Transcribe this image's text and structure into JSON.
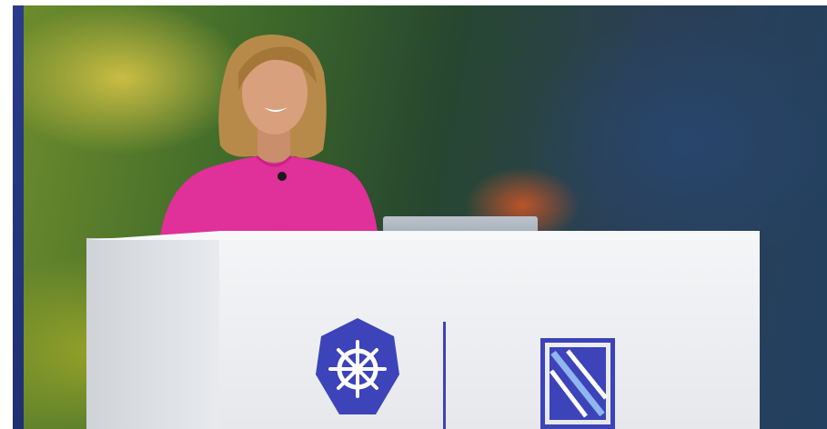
{
  "scene": {
    "description_colors": {
      "backdrop_green": "#3f6a2a",
      "backdrop_blue": "#2b3f55",
      "autumn_orange": "#c45428",
      "jacket_pink": "#e0309a",
      "hair_blonde": "#b88a4a",
      "lectern_white": "#eef0f3",
      "logo_blue": "#3d43b8"
    },
    "icons": {
      "lectern_logo_left": "kubernetes-helm-icon",
      "lectern_logo_right": "cncf-icon",
      "microphone": "lapel-mic-icon"
    }
  }
}
